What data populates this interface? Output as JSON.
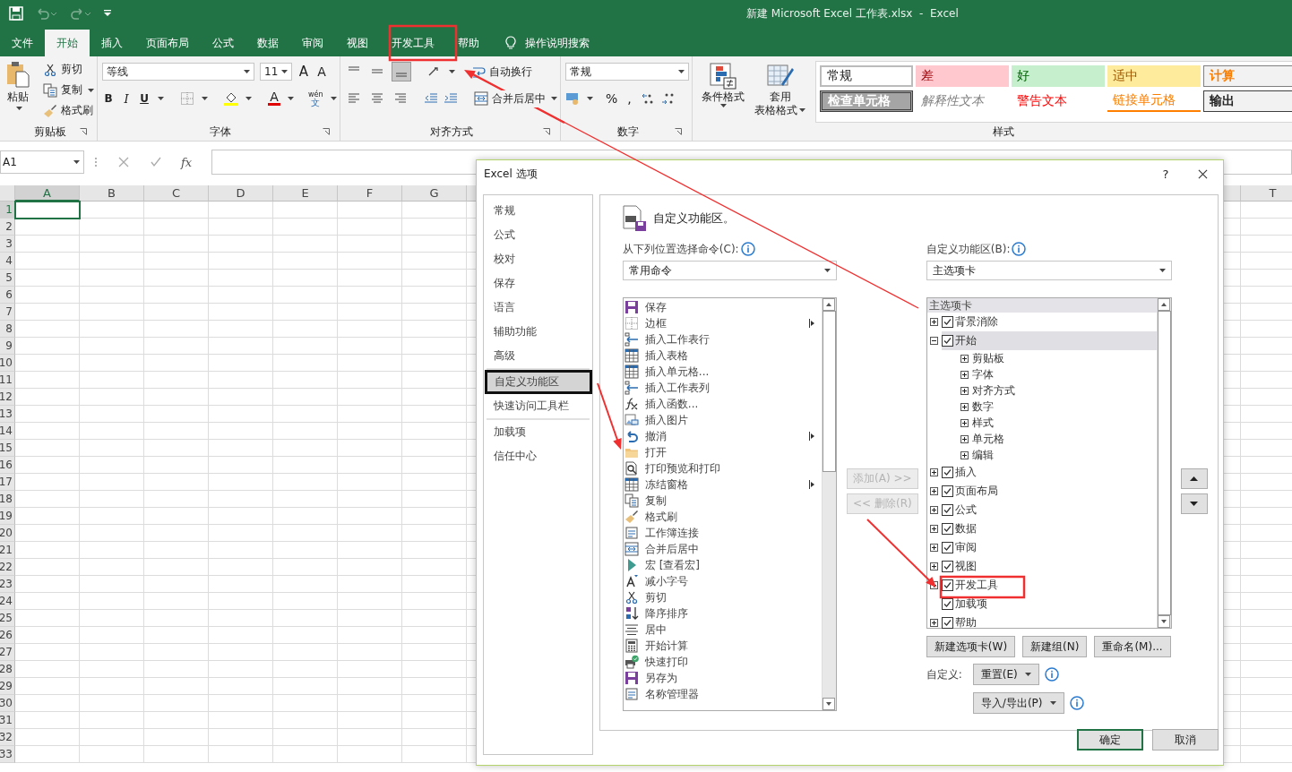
{
  "window": {
    "title": "新建 Microsoft Excel 工作表.xlsx  -  Excel"
  },
  "ribbon_tabs": [
    {
      "label": "文件",
      "selected": false
    },
    {
      "label": "开始",
      "selected": true
    },
    {
      "label": "插入",
      "selected": false
    },
    {
      "label": "页面布局",
      "selected": false
    },
    {
      "label": "公式",
      "selected": false
    },
    {
      "label": "数据",
      "selected": false
    },
    {
      "label": "审阅",
      "selected": false
    },
    {
      "label": "视图",
      "selected": false
    },
    {
      "label": "开发工具",
      "selected": false
    },
    {
      "label": "帮助",
      "selected": false
    }
  ],
  "tell_me": "操作说明搜索",
  "ribbon": {
    "clipboard": {
      "paste": "粘贴",
      "cut": "剪切",
      "copy": "复制",
      "format_painter": "格式刷",
      "label": "剪贴板"
    },
    "font": {
      "name": "等线",
      "size": "11",
      "grow": "A",
      "shrink": "A",
      "bold": "B",
      "italic": "I",
      "underline": "U",
      "font_color": "A",
      "phonetic_top": "wén",
      "phonetic_bottom": "文",
      "label": "字体"
    },
    "alignment": {
      "wrap": "自动换行",
      "merge": "合并后居中",
      "label": "对齐方式"
    },
    "number": {
      "format": "常规",
      "percent": "%",
      "comma": ",",
      "label": "数字"
    },
    "conditional_format": "条件格式",
    "table_format_top": "套用",
    "table_format_bottom": "表格格式",
    "styles": {
      "label": "样式",
      "items": [
        {
          "label": "常规",
          "kind": "normal"
        },
        {
          "label": "差",
          "kind": "bad"
        },
        {
          "label": "好",
          "kind": "good"
        },
        {
          "label": "适中",
          "kind": "neutral"
        },
        {
          "label": "计算",
          "kind": "calculation"
        },
        {
          "label": "检查单元格",
          "kind": "check"
        },
        {
          "label": "解释性文本",
          "kind": "explanatory"
        },
        {
          "label": "警告文本",
          "kind": "warning"
        },
        {
          "label": "链接单元格",
          "kind": "linked"
        },
        {
          "label": "输出",
          "kind": "output"
        }
      ]
    }
  },
  "formula_bar": {
    "name_box": "A1",
    "function": "fx"
  },
  "sheet": {
    "columns": [
      {
        "label": "A",
        "selected": true
      },
      {
        "label": "B",
        "selected": false
      },
      {
        "label": "C",
        "selected": false
      },
      {
        "label": "D",
        "selected": false
      },
      {
        "label": "E",
        "selected": false
      },
      {
        "label": "F",
        "selected": false
      },
      {
        "label": "G",
        "selected": false
      },
      {
        "label": "T",
        "selected": false
      }
    ],
    "rows": [
      {
        "label": "1",
        "selected": true
      },
      {
        "label": "2",
        "selected": false
      },
      {
        "label": "3",
        "selected": false
      },
      {
        "label": "4",
        "selected": false
      },
      {
        "label": "5",
        "selected": false
      },
      {
        "label": "6",
        "selected": false
      },
      {
        "label": "7",
        "selected": false
      },
      {
        "label": "8",
        "selected": false
      },
      {
        "label": "9",
        "selected": false
      },
      {
        "label": "10",
        "selected": false
      },
      {
        "label": "11",
        "selected": false
      },
      {
        "label": "12",
        "selected": false
      },
      {
        "label": "13",
        "selected": false
      },
      {
        "label": "14",
        "selected": false
      },
      {
        "label": "15",
        "selected": false
      },
      {
        "label": "16",
        "selected": false
      },
      {
        "label": "17",
        "selected": false
      },
      {
        "label": "18",
        "selected": false
      },
      {
        "label": "19",
        "selected": false
      },
      {
        "label": "20",
        "selected": false
      },
      {
        "label": "21",
        "selected": false
      },
      {
        "label": "22",
        "selected": false
      },
      {
        "label": "23",
        "selected": false
      },
      {
        "label": "24",
        "selected": false
      },
      {
        "label": "25",
        "selected": false
      },
      {
        "label": "26",
        "selected": false
      },
      {
        "label": "27",
        "selected": false
      },
      {
        "label": "28",
        "selected": false
      },
      {
        "label": "29",
        "selected": false
      },
      {
        "label": "30",
        "selected": false
      },
      {
        "label": "31",
        "selected": false
      },
      {
        "label": "32",
        "selected": false
      },
      {
        "label": "33",
        "selected": false
      }
    ]
  },
  "dialog": {
    "title": "Excel 选项",
    "help": "?",
    "nav": [
      {
        "label": "常规",
        "selected": false
      },
      {
        "label": "公式",
        "selected": false
      },
      {
        "label": "校对",
        "selected": false
      },
      {
        "label": "保存",
        "selected": false
      },
      {
        "label": "语言",
        "selected": false
      },
      {
        "label": "辅助功能",
        "selected": false
      },
      {
        "label": "高级",
        "selected": false
      },
      {
        "label": "自定义功能区",
        "selected": true
      },
      {
        "label": "快速访问工具栏",
        "selected": false
      },
      {
        "label": "加载项",
        "selected": false
      },
      {
        "label": "信任中心",
        "selected": false
      }
    ],
    "heading": "自定义功能区。",
    "commands_from": {
      "label": "从下列位置选择命令(C):",
      "value": "常用命令"
    },
    "commands": [
      {
        "label": "保存",
        "submenu": false
      },
      {
        "label": "边框",
        "submenu": true
      },
      {
        "label": "插入工作表行",
        "submenu": false
      },
      {
        "label": "插入表格",
        "submenu": false
      },
      {
        "label": "插入单元格...",
        "submenu": false
      },
      {
        "label": "插入工作表列",
        "submenu": false
      },
      {
        "label": "插入函数...",
        "submenu": false
      },
      {
        "label": "插入图片",
        "submenu": false
      },
      {
        "label": "撤消",
        "submenu": true
      },
      {
        "label": "打开",
        "submenu": false
      },
      {
        "label": "打印预览和打印",
        "submenu": false
      },
      {
        "label": "冻结窗格",
        "submenu": true
      },
      {
        "label": "复制",
        "submenu": false
      },
      {
        "label": "格式刷",
        "submenu": false
      },
      {
        "label": "工作簿连接",
        "submenu": false
      },
      {
        "label": "合并后居中",
        "submenu": false
      },
      {
        "label": "宏 [查看宏]",
        "submenu": false
      },
      {
        "label": "减小字号",
        "submenu": false
      },
      {
        "label": "剪切",
        "submenu": false
      },
      {
        "label": "降序排序",
        "submenu": false
      },
      {
        "label": "居中",
        "submenu": false
      },
      {
        "label": "开始计算",
        "submenu": false
      },
      {
        "label": "快速打印",
        "submenu": false
      },
      {
        "label": "另存为",
        "submenu": false
      },
      {
        "label": "名称管理器",
        "submenu": false
      }
    ],
    "add": {
      "label": "添加(A) >>",
      "disabled": true
    },
    "remove": {
      "label": "<< 删除(R)",
      "disabled": true
    },
    "customize": {
      "label": "自定义功能区(B):",
      "value": "主选项卡"
    },
    "tree": {
      "header": "主选项卡",
      "items": [
        {
          "label": "背景消除",
          "checked": true,
          "expandable": true,
          "expanded": false,
          "selected": false
        },
        {
          "label": "开始",
          "checked": true,
          "expandable": true,
          "expanded": true,
          "selected": true,
          "children": [
            {
              "label": "剪贴板"
            },
            {
              "label": "字体"
            },
            {
              "label": "对齐方式"
            },
            {
              "label": "数字"
            },
            {
              "label": "样式"
            },
            {
              "label": "单元格"
            },
            {
              "label": "编辑"
            }
          ]
        },
        {
          "label": "插入",
          "checked": true,
          "expandable": true,
          "expanded": false,
          "selected": false
        },
        {
          "label": "页面布局",
          "checked": true,
          "expandable": true,
          "expanded": false,
          "selected": false
        },
        {
          "label": "公式",
          "checked": true,
          "expandable": true,
          "expanded": false,
          "selected": false
        },
        {
          "label": "数据",
          "checked": true,
          "expandable": true,
          "expanded": false,
          "selected": false
        },
        {
          "label": "审阅",
          "checked": true,
          "expandable": true,
          "expanded": false,
          "selected": false
        },
        {
          "label": "视图",
          "checked": true,
          "expandable": true,
          "expanded": false,
          "selected": false
        },
        {
          "label": "开发工具",
          "checked": true,
          "expandable": true,
          "expanded": false,
          "selected": false
        },
        {
          "label": "加载项",
          "checked": true,
          "expandable": false,
          "expanded": false,
          "selected": false
        },
        {
          "label": "帮助",
          "checked": true,
          "expandable": true,
          "expanded": false,
          "selected": false
        }
      ]
    },
    "tree_buttons": [
      "新建选项卡(W)",
      "新建组(N)",
      "重命名(M)..."
    ],
    "customizations": {
      "label": "自定义:",
      "reset": "重置(E)",
      "import_export": "导入/导出(P)"
    },
    "buttons": [
      {
        "label": "确定",
        "default": true
      },
      {
        "label": "取消",
        "default": false
      }
    ]
  }
}
